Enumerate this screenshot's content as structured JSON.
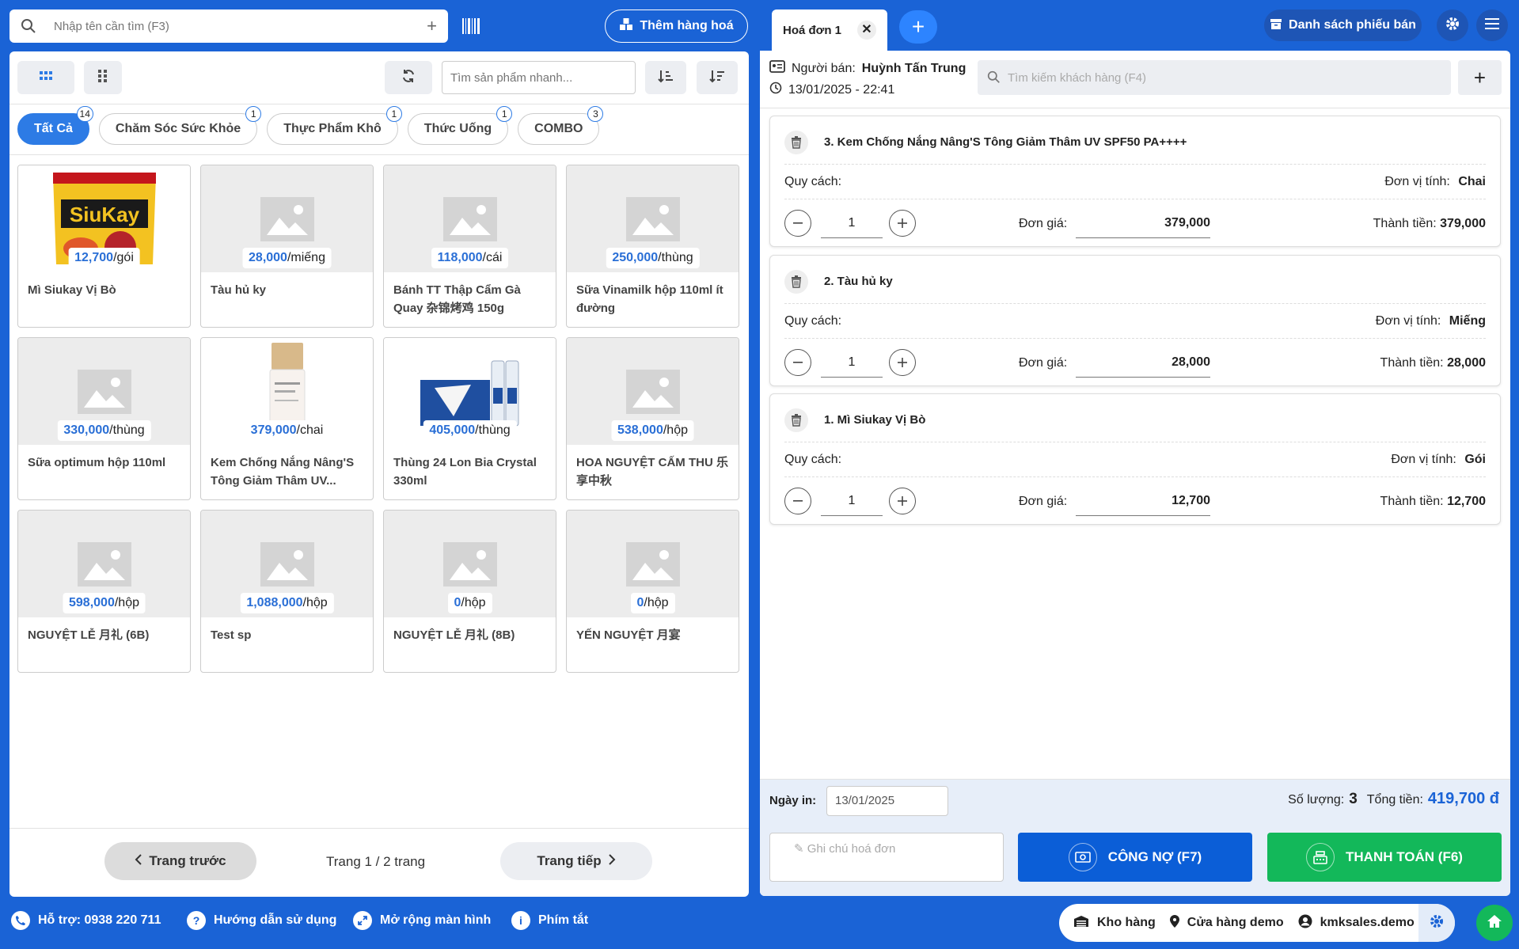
{
  "search": {
    "placeholder": "Nhập tên cần tìm (F3)"
  },
  "header": {
    "add_goods_label": "Thêm hàng hoá"
  },
  "toolbar": {
    "quick_search_placeholder": "Tìm sản phẩm nhanh..."
  },
  "categories": [
    {
      "label": "Tất Cả",
      "count": "14"
    },
    {
      "label": "Chăm Sóc Sức Khỏe",
      "count": "1"
    },
    {
      "label": "Thực Phẩm Khô",
      "count": "1"
    },
    {
      "label": "Thức Uống",
      "count": "1"
    },
    {
      "label": "COMBO",
      "count": "3"
    }
  ],
  "products": [
    {
      "price": "12,700",
      "unit": "/gói",
      "name": "Mì Siukay Vị Bò",
      "image": "noodle-pack"
    },
    {
      "price": "28,000",
      "unit": "/miếng",
      "name": "Tàu hủ ky",
      "image": "placeholder"
    },
    {
      "price": "118,000",
      "unit": "/cái",
      "name": "Bánh TT Thập Cẩm Gà Quay 杂锦烤鸡 150g",
      "image": "placeholder"
    },
    {
      "price": "250,000",
      "unit": "/thùng",
      "name": "Sữa Vinamilk hộp 110ml ít đường",
      "image": "placeholder"
    },
    {
      "price": "330,000",
      "unit": "/thùng",
      "name": "Sữa optimum hộp 110ml",
      "image": "placeholder"
    },
    {
      "price": "379,000",
      "unit": "/chai",
      "name": "Kem Chống Nắng Nâng'S Tông Giảm Thâm UV...",
      "image": "sunscreen-bottle"
    },
    {
      "price": "405,000",
      "unit": "/thùng",
      "name": "Thùng 24 Lon Bia Crystal 330ml",
      "image": "beer-case"
    },
    {
      "price": "538,000",
      "unit": "/hộp",
      "name": "HOA NGUYỆT CẤM THU 乐享中秋",
      "image": "placeholder"
    },
    {
      "price": "598,000",
      "unit": "/hộp",
      "name": "NGUYỆT LỄ 月礼 (6B)",
      "image": "placeholder"
    },
    {
      "price": "1,088,000",
      "unit": "/hộp",
      "name": "Test sp",
      "image": "placeholder"
    },
    {
      "price": "0",
      "unit": "/hộp",
      "name": "NGUYỆT LỄ 月礼 (8B)",
      "image": "placeholder"
    },
    {
      "price": "0",
      "unit": "/hộp",
      "name": "YẾN NGUYỆT 月宴",
      "image": "placeholder"
    }
  ],
  "pager": {
    "prev": "Trang trước",
    "text": "Trang 1 / 2 trang",
    "next": "Trang tiếp"
  },
  "invoice_tab": {
    "label": "Hoá đơn 1"
  },
  "sales_list_label": "Danh sách phiếu bán",
  "seller": {
    "label": "Người bán:",
    "name": "Huỳnh Tấn Trung",
    "datetime": "13/01/2025 - 22:41"
  },
  "customer_search": {
    "placeholder": "Tìm kiếm khách hàng (F4)"
  },
  "invoice_items": [
    {
      "title": "3.  Kem Chống Nắng Nâng'S Tông Giảm Thâm UV SPF50 PA++++",
      "spec_label": "Quy cách:",
      "unit_label": "Đơn vị tính:",
      "unit": "Chai",
      "qty": "1",
      "price_label": "Đơn giá:",
      "price": "379,000",
      "total_label": "Thành tiền:",
      "total": "379,000"
    },
    {
      "title": "2.  Tàu hủ ky",
      "spec_label": "Quy cách:",
      "unit_label": "Đơn vị tính:",
      "unit": "Miếng",
      "qty": "1",
      "price_label": "Đơn giá:",
      "price": "28,000",
      "total_label": "Thành tiền:",
      "total": "28,000"
    },
    {
      "title": "1.  Mì Siukay Vị Bò",
      "spec_label": "Quy cách:",
      "unit_label": "Đơn vị tính:",
      "unit": "Gói",
      "qty": "1",
      "price_label": "Đơn giá:",
      "price": "12,700",
      "total_label": "Thành tiền:",
      "total": "12,700"
    }
  ],
  "footer": {
    "date_label": "Ngày in:",
    "date_value": "13/01/2025",
    "qty_label": "Số lượng:",
    "qty_value": "3",
    "total_label": "Tổng tiền:",
    "total_value": "419,700 đ",
    "note_placeholder": "✎ Ghi chú hoá đơn",
    "debt_button": "CÔNG NỢ (F7)",
    "pay_button": "THANH TOÁN (F6)"
  },
  "bottom_bar": {
    "support": "Hỗ trợ: 0938 220 711",
    "guide": "Hướng dẫn sử dụng",
    "expand": "Mở rộng màn hình",
    "shortcuts": "Phím tắt",
    "warehouse": "Kho hàng",
    "store": "Cửa hàng demo",
    "account": "kmksales.demo"
  },
  "colors": {
    "primary": "#1a63d6",
    "accent_blue": "#2d7be5",
    "pay_green": "#13b85a",
    "debt_blue": "#0b5ed7"
  }
}
